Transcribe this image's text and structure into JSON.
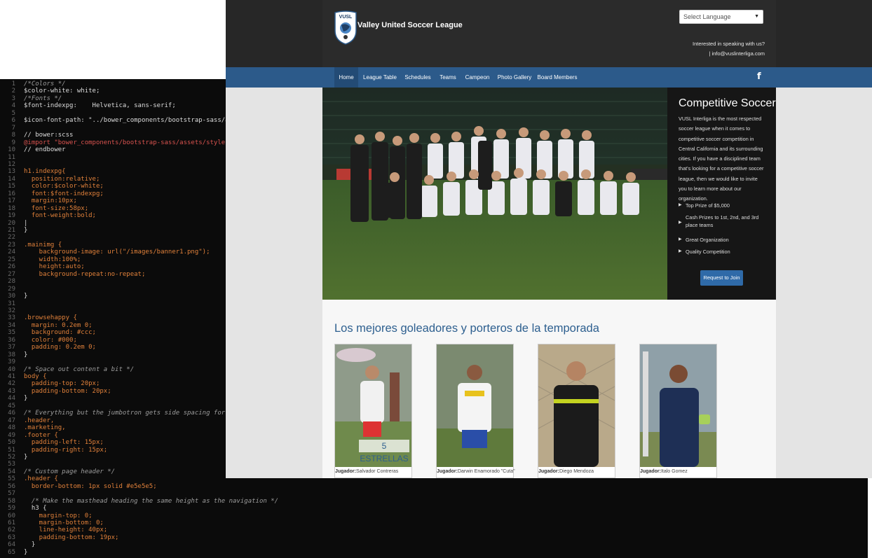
{
  "editor": {
    "lines": [
      {
        "n": "1",
        "t": "/*Colors */",
        "c": "comment"
      },
      {
        "n": "2",
        "t": "$color-white: white;"
      },
      {
        "n": "3",
        "t": "/*Fonts */",
        "c": "comment"
      },
      {
        "n": "4",
        "t": "$font-indexpg:    Helvetica, sans-serif;"
      },
      {
        "n": "5",
        "t": ""
      },
      {
        "n": "6",
        "t": "$icon-font-path: \"../bower_components/bootstrap-sass/assets/fonts/bootstrap/\";"
      },
      {
        "n": "7",
        "t": ""
      },
      {
        "n": "8",
        "t": "// bower:scss"
      },
      {
        "n": "9",
        "t": "@import \"bower_components/bootstrap-sass/assets/stylesheets/_bootstrap.scss\";",
        "c": "red"
      },
      {
        "n": "10",
        "t": "// endbower"
      },
      {
        "n": "11",
        "t": ""
      },
      {
        "n": "12",
        "t": ""
      },
      {
        "n": "13",
        "t": "h1.indexpg{",
        "c": "orange"
      },
      {
        "n": "14",
        "t": "  position:relative;",
        "c": "orange"
      },
      {
        "n": "15",
        "t": "  color:$color-white;",
        "c": "orange"
      },
      {
        "n": "16",
        "t": "  font:$font-indexpg;",
        "c": "orange"
      },
      {
        "n": "17",
        "t": "  margin:10px;",
        "c": "orange"
      },
      {
        "n": "18",
        "t": "  font-size:58px;",
        "c": "orange"
      },
      {
        "n": "19",
        "t": "  font-weight:bold;",
        "c": "orange"
      },
      {
        "n": "20",
        "t": "|"
      },
      {
        "n": "21",
        "t": "}"
      },
      {
        "n": "22",
        "t": ""
      },
      {
        "n": "23",
        "t": ".mainimg {",
        "c": "orange"
      },
      {
        "n": "24",
        "t": "    background-image: url(\"/images/banner1.png\");",
        "c": "orange"
      },
      {
        "n": "25",
        "t": "    width:100%;",
        "c": "orange"
      },
      {
        "n": "26",
        "t": "    height:auto;",
        "c": "orange"
      },
      {
        "n": "27",
        "t": "    background-repeat:no-repeat;",
        "c": "orange"
      },
      {
        "n": "28",
        "t": ""
      },
      {
        "n": "29",
        "t": ""
      },
      {
        "n": "30",
        "t": "}"
      },
      {
        "n": "31",
        "t": ""
      },
      {
        "n": "32",
        "t": ""
      },
      {
        "n": "33",
        "t": ".browsehappy {",
        "c": "orange"
      },
      {
        "n": "34",
        "t": "  margin: 0.2em 0;",
        "c": "orange"
      },
      {
        "n": "35",
        "t": "  background: #ccc;",
        "c": "orange"
      },
      {
        "n": "36",
        "t": "  color: #000;",
        "c": "orange"
      },
      {
        "n": "37",
        "t": "  padding: 0.2em 0;",
        "c": "orange"
      },
      {
        "n": "38",
        "t": "}"
      },
      {
        "n": "39",
        "t": ""
      },
      {
        "n": "40",
        "t": "/* Space out content a bit */",
        "c": "comment"
      },
      {
        "n": "41",
        "t": "body {",
        "c": "orange"
      },
      {
        "n": "42",
        "t": "  padding-top: 20px;",
        "c": "orange"
      },
      {
        "n": "43",
        "t": "  padding-bottom: 20px;",
        "c": "orange"
      },
      {
        "n": "44",
        "t": "}"
      },
      {
        "n": "45",
        "t": ""
      },
      {
        "n": "46",
        "t": "/* Everything but the jumbotron gets side spacing for mobile first views */",
        "c": "comment"
      },
      {
        "n": "47",
        "t": ".header,",
        "c": "orange"
      },
      {
        "n": "48",
        "t": ".marketing,",
        "c": "orange"
      },
      {
        "n": "49",
        "t": ".footer {",
        "c": "orange"
      },
      {
        "n": "50",
        "t": "  padding-left: 15px;",
        "c": "orange"
      },
      {
        "n": "51",
        "t": "  padding-right: 15px;",
        "c": "orange"
      },
      {
        "n": "52",
        "t": "}"
      },
      {
        "n": "53",
        "t": ""
      },
      {
        "n": "54",
        "t": "/* Custom page header */",
        "c": "comment"
      },
      {
        "n": "55",
        "t": ".header {",
        "c": "orange"
      },
      {
        "n": "56",
        "t": "  border-bottom: 1px solid #e5e5e5;",
        "c": "orange"
      },
      {
        "n": "57",
        "t": ""
      },
      {
        "n": "58",
        "t": "  /* Make the masthead heading the same height as the navigation */",
        "c": "comment"
      },
      {
        "n": "59",
        "t": "  h3 {"
      },
      {
        "n": "60",
        "t": "    margin-top: 0;",
        "c": "orange"
      },
      {
        "n": "61",
        "t": "    margin-bottom: 0;",
        "c": "orange"
      },
      {
        "n": "62",
        "t": "    line-height: 40px;",
        "c": "orange"
      },
      {
        "n": "63",
        "t": "    padding-bottom: 19px;",
        "c": "orange"
      },
      {
        "n": "64",
        "t": "  }"
      },
      {
        "n": "65",
        "t": "}"
      }
    ]
  },
  "site": {
    "brand": "Valley United Soccer League",
    "logo_text": "VUSL",
    "language_select": "Select Language",
    "contact_line1": "Interested in speaking with us?",
    "contact_line2": "| info@vuslinterliga.com",
    "nav": [
      "Home",
      "League Table",
      "Schedules",
      "Teams",
      "Campeon",
      "Photo Gallery",
      "Board Members"
    ],
    "sidebar": {
      "title": "Competitive Soccer",
      "text": "VUSL Interliga is the most respected soccer league when it comes to competitive soccer competition in Central California and its surrounding cities. If you have a disciplined team that's looking for a competitive soccer league, then we would like to invite you to learn more about our organization.",
      "bullets": [
        "Top Prize of $5,000",
        "Cash Prizes to 1st, 2nd, and 3rd place teams",
        "Great Organization",
        "Quality Competition"
      ],
      "button": "Request to Join"
    },
    "section_title": "Los mejores goleadores y porteros de la temporada",
    "player_label": "Jugador:",
    "players": [
      {
        "name": "Salvador Contreras",
        "overlay": "5 ESTRELLAS"
      },
      {
        "name": "Darwin Enamorado \"Cuta\""
      },
      {
        "name": "Diego Mendoza"
      },
      {
        "name": "Italo Gomez"
      }
    ]
  },
  "colors": {
    "editor_bg": "#0b0b0b",
    "nav_bg": "#2c5a8a",
    "header_bg": "#2b2b2b",
    "accent": "#2d5f8f"
  }
}
